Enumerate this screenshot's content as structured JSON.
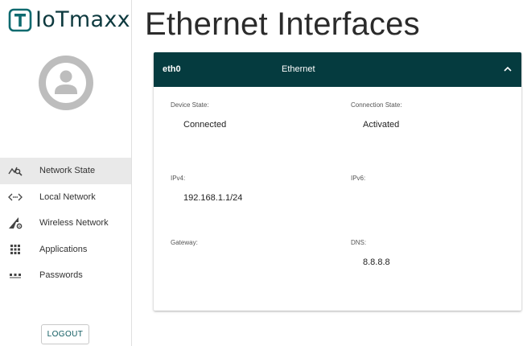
{
  "app": {
    "logo_text": "IoTmaxx"
  },
  "sidebar": {
    "items": [
      {
        "label": "Network State",
        "icon": "network-state-icon",
        "active": true
      },
      {
        "label": "Local Network",
        "icon": "code-arrows-icon",
        "active": false
      },
      {
        "label": "Wireless Network",
        "icon": "wireless-settings-icon",
        "active": false
      },
      {
        "label": "Applications",
        "icon": "apps-grid-icon",
        "active": false
      },
      {
        "label": "Passwords",
        "icon": "password-dots-icon",
        "active": false
      }
    ],
    "logout_label": "LOGOUT"
  },
  "main": {
    "title": "Ethernet Interfaces",
    "interface": {
      "name": "eth0",
      "type": "Ethernet",
      "expanded": true,
      "fields": {
        "device_state_label": "Device State:",
        "device_state_value": "Connected",
        "connection_state_label": "Connection State:",
        "connection_state_value": "Activated",
        "ipv4_label": "IPv4:",
        "ipv4_value": "192.168.1.1/24",
        "ipv6_label": "IPv6:",
        "ipv6_value": "",
        "gateway_label": "Gateway:",
        "gateway_value": "",
        "dns_label": "DNS:",
        "dns_value": "8.8.8.8"
      }
    }
  },
  "colors": {
    "brand": "#0e3a3f",
    "header_bg": "#053b3f",
    "active_nav_bg": "#e9e9e9",
    "avatar_gray": "#bdbdbd"
  }
}
